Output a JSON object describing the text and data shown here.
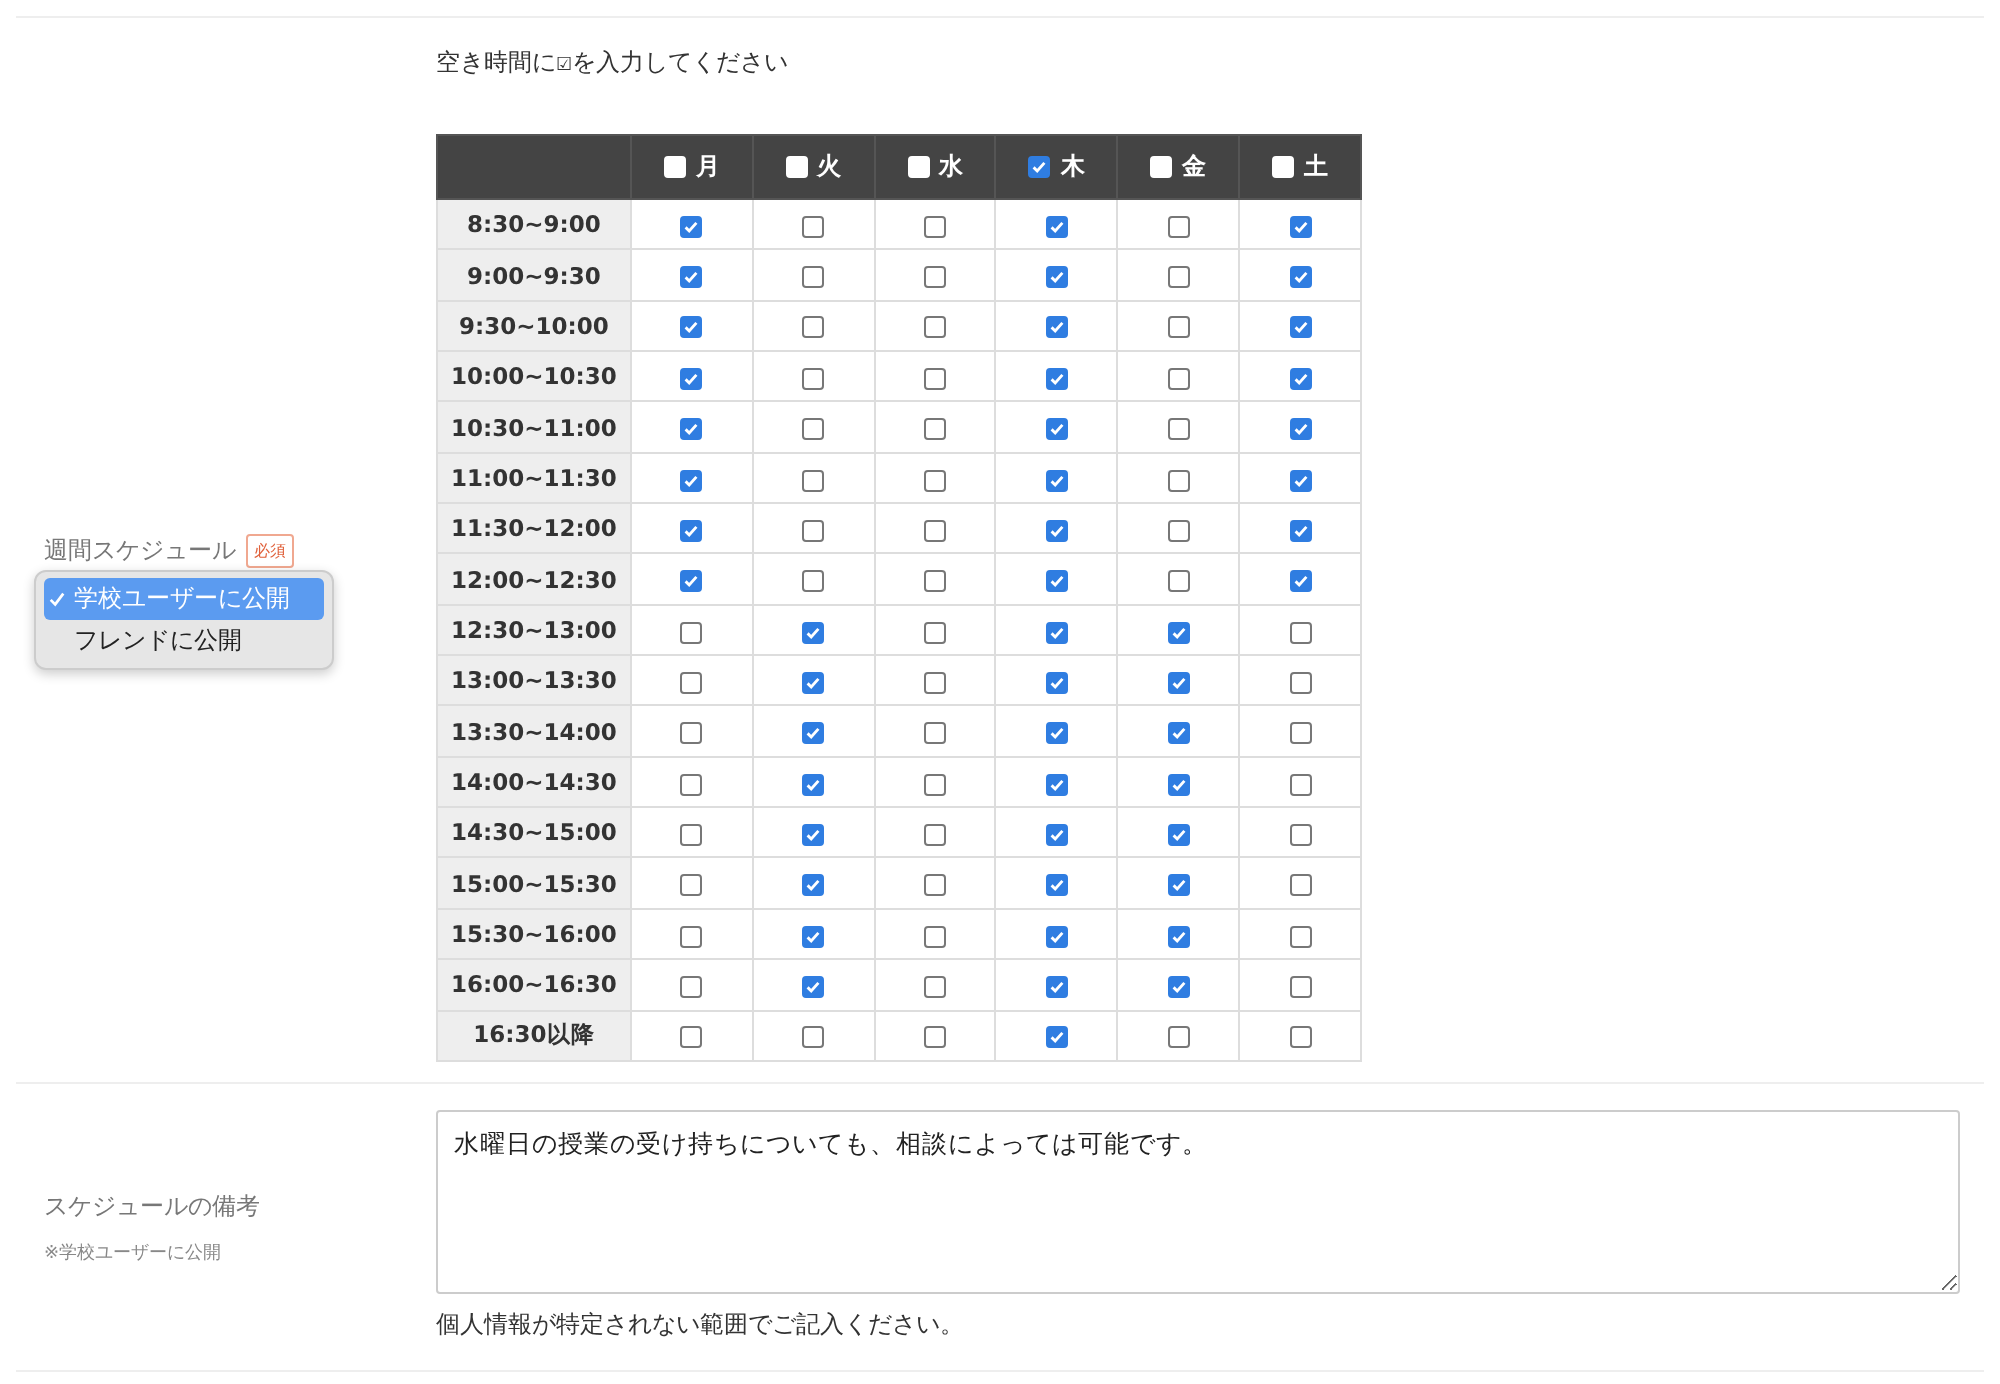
{
  "schedule": {
    "label": "週間スケジュール",
    "required_badge": "必須",
    "visibility_menu": [
      {
        "label": "学校ユーザーに公開",
        "selected": true
      },
      {
        "label": "フレンドに公開",
        "selected": false
      }
    ],
    "instruction_before": "空き時間に",
    "instruction_mark": "☑",
    "instruction_after": "を入力してください",
    "days": [
      {
        "label": "月",
        "checked": false
      },
      {
        "label": "火",
        "checked": false
      },
      {
        "label": "水",
        "checked": false
      },
      {
        "label": "木",
        "checked": true
      },
      {
        "label": "金",
        "checked": false
      },
      {
        "label": "土",
        "checked": false
      }
    ],
    "rows": [
      {
        "time": "8:30~9:00",
        "checks": [
          true,
          false,
          false,
          true,
          false,
          true
        ]
      },
      {
        "time": "9:00~9:30",
        "checks": [
          true,
          false,
          false,
          true,
          false,
          true
        ]
      },
      {
        "time": "9:30~10:00",
        "checks": [
          true,
          false,
          false,
          true,
          false,
          true
        ]
      },
      {
        "time": "10:00~10:30",
        "checks": [
          true,
          false,
          false,
          true,
          false,
          true
        ]
      },
      {
        "time": "10:30~11:00",
        "checks": [
          true,
          false,
          false,
          true,
          false,
          true
        ]
      },
      {
        "time": "11:00~11:30",
        "checks": [
          true,
          false,
          false,
          true,
          false,
          true
        ]
      },
      {
        "time": "11:30~12:00",
        "checks": [
          true,
          false,
          false,
          true,
          false,
          true
        ]
      },
      {
        "time": "12:00~12:30",
        "checks": [
          true,
          false,
          false,
          true,
          false,
          true
        ]
      },
      {
        "time": "12:30~13:00",
        "checks": [
          false,
          true,
          false,
          true,
          true,
          false
        ]
      },
      {
        "time": "13:00~13:30",
        "checks": [
          false,
          true,
          false,
          true,
          true,
          false
        ]
      },
      {
        "time": "13:30~14:00",
        "checks": [
          false,
          true,
          false,
          true,
          true,
          false
        ]
      },
      {
        "time": "14:00~14:30",
        "checks": [
          false,
          true,
          false,
          true,
          true,
          false
        ]
      },
      {
        "time": "14:30~15:00",
        "checks": [
          false,
          true,
          false,
          true,
          true,
          false
        ]
      },
      {
        "time": "15:00~15:30",
        "checks": [
          false,
          true,
          false,
          true,
          true,
          false
        ]
      },
      {
        "time": "15:30~16:00",
        "checks": [
          false,
          true,
          false,
          true,
          true,
          false
        ]
      },
      {
        "time": "16:00~16:30",
        "checks": [
          false,
          true,
          false,
          true,
          true,
          false
        ]
      },
      {
        "time": "16:30以降",
        "checks": [
          false,
          false,
          false,
          true,
          false,
          false
        ]
      }
    ]
  },
  "remarks": {
    "label": "スケジュールの備考",
    "note": "※学校ユーザーに公開",
    "value": "水曜日の授業の受け持ちについても、相談によっては可能です。",
    "help": "個人情報が特定されない範囲でご記入ください。"
  }
}
